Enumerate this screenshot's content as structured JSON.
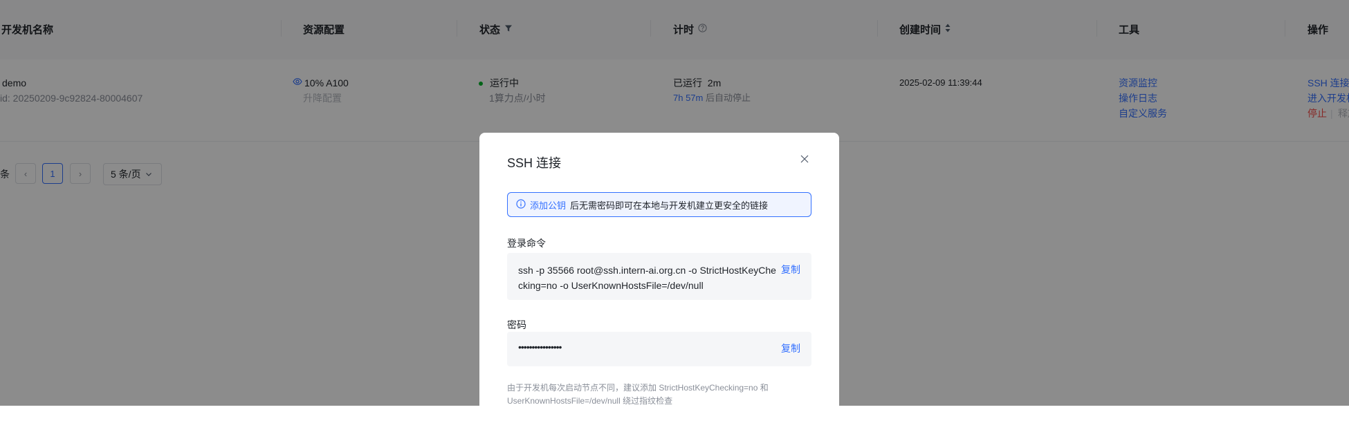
{
  "table": {
    "headers": {
      "name": "开发机名称",
      "resource": "资源配置",
      "status": "状态",
      "timer": "计时",
      "created": "创建时间",
      "tools": "工具",
      "actions": "操作"
    },
    "row": {
      "name": "demo",
      "id": "id: 20250209-9c92824-80004607",
      "resource_value": "10% A100",
      "resource_action": "升降配置",
      "status": "运行中",
      "status_rate": "1算力点/小时",
      "timer_running_label": "已运行",
      "timer_running_value": "2m",
      "timer_remaining": "7h 57m",
      "timer_auto_stop": "后自动停止",
      "created_time": "2025-02-09 11:39:44",
      "tools": [
        "资源监控",
        "操作日志",
        "自定义服务"
      ],
      "actions": [
        "SSH 连接",
        "进入开发机",
        "停止",
        "释放"
      ]
    }
  },
  "pagination": {
    "total_suffix": "条",
    "prev_glyph": "‹",
    "current_page": "1",
    "next_glyph": "›",
    "page_size": "5 条/页"
  },
  "modal": {
    "title": "SSH 连接",
    "notice_link": "添加公钥",
    "notice_text": "后无需密码即可在本地与开发机建立更安全的链接",
    "login_label": "登录命令",
    "login_command": "ssh -p 35566 root@ssh.intern-ai.org.cn -o StrictHostKeyChecking=no -o UserKnownHostsFile=/dev/null",
    "password_label": "密码",
    "password_masked": "••••••••••••••••",
    "copy_label": "复制",
    "hint": "由于开发机每次启动节点不同，建议添加 StrictHostKeyChecking=no 和 UserKnownHostsFile=/dev/null 绕过指纹检查"
  },
  "colors": {
    "accent": "#3370ff",
    "running": "#00b42a",
    "danger": "#f54a45"
  }
}
